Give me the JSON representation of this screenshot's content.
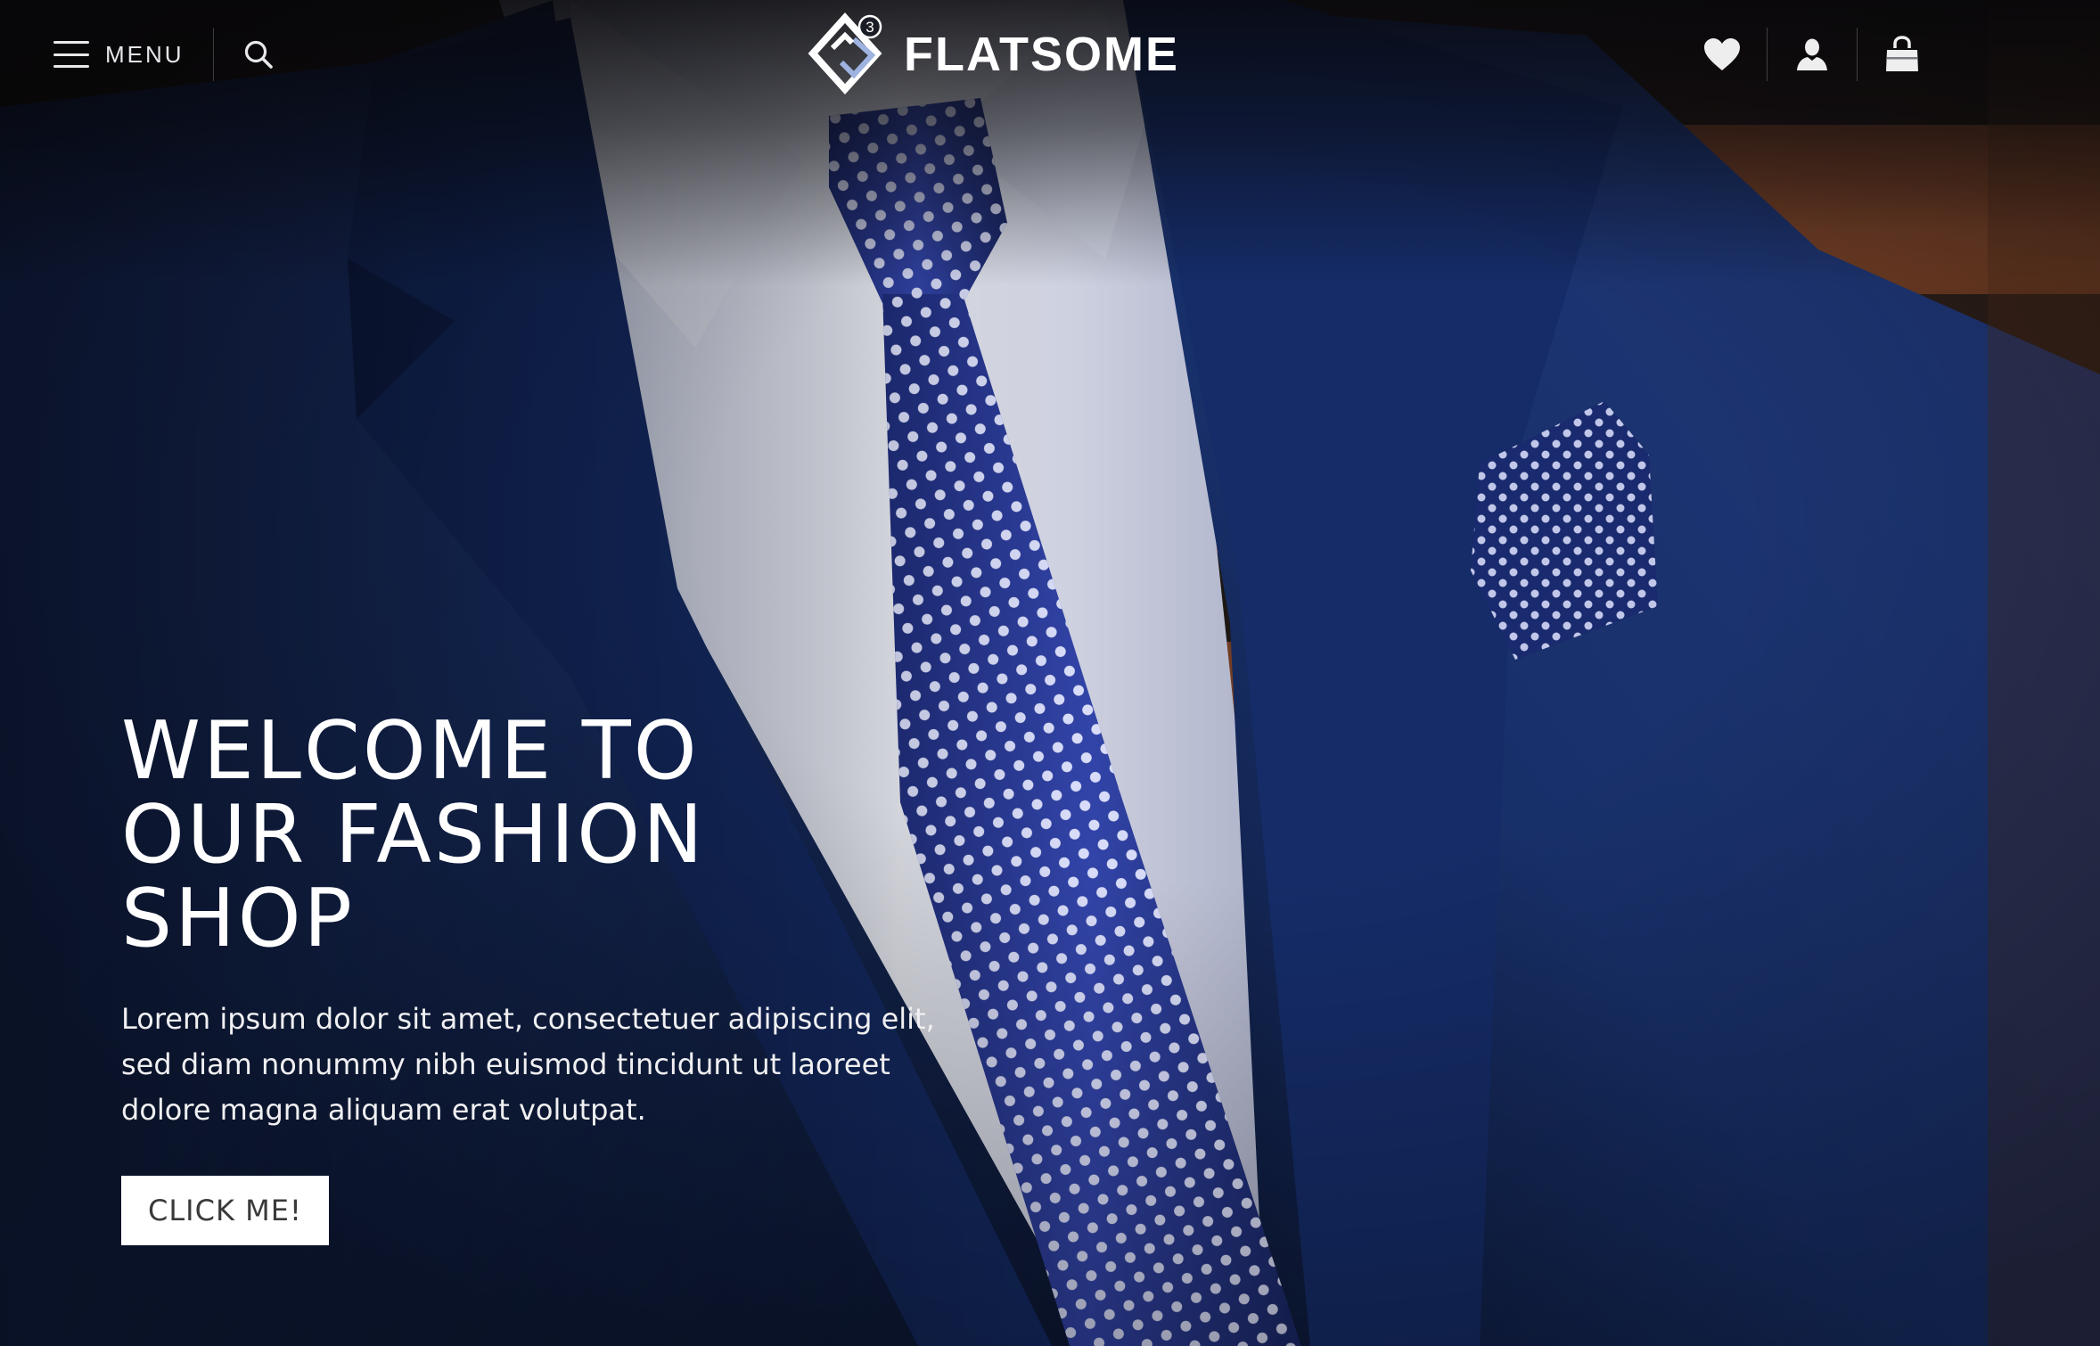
{
  "header": {
    "menu_label": "MENU",
    "logo_text": "FLATSOME",
    "logo_badge": "3",
    "icons": {
      "menu": "hamburger-icon",
      "search": "search-icon",
      "wishlist": "heart-icon",
      "account": "user-icon",
      "cart": "shopping-bag-icon"
    }
  },
  "hero": {
    "title_lines": [
      "WELCOME TO",
      "OUR FASHION",
      "SHOP"
    ],
    "text": "Lorem ipsum dolor sit amet, consectetuer adipiscing elit, sed diam nonummy nibh euismod tincidunt ut laoreet dolore magna aliquam erat volutpat.",
    "button_label": "CLICK ME!"
  },
  "colors": {
    "header_text": "#ffffff",
    "button_bg": "#ffffff",
    "button_text": "#3a3a3a",
    "suit_blue": "#1f3a78",
    "tie_blue": "#2e3f9a"
  }
}
